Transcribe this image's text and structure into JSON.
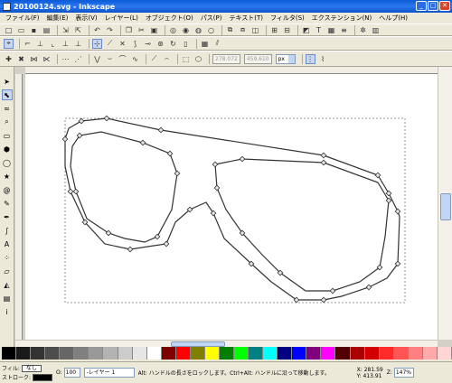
{
  "window": {
    "title": "20100124.svg - Inkscape"
  },
  "menu": [
    "ファイル(F)",
    "編集(E)",
    "表示(V)",
    "レイヤー(L)",
    "オブジェクト(O)",
    "パス(P)",
    "テキスト(T)",
    "フィルタ(S)",
    "エクステンション(N)",
    "ヘルプ(H)"
  ],
  "toolbar2": {
    "x_value": "278.072",
    "w_value": "459.610",
    "unit": "px"
  },
  "status": {
    "fill_label": "フィル:",
    "fill_value": "なし",
    "stroke_label": "ストローク:",
    "opacity_label": "O:",
    "opacity_value": "100",
    "layer": "-レイヤー 1",
    "message": "Alt: ハンドルの長さをロックします。Ctrl+Alt: ハンドルに沿って移動します。",
    "x_label": "X:",
    "x_value": "281.59",
    "y_label": "Y:",
    "y_value": "413.91",
    "zoom_label": "Z:",
    "zoom_value": "147%"
  },
  "colors": {
    "titlebar": "#0a5bd8",
    "path_stroke": "#333333",
    "node": "#e6e6e6"
  },
  "icons": {
    "tools": [
      "selector-icon",
      "node-icon",
      "tweak-icon",
      "zoom-icon",
      "rect-icon",
      "3dbox-icon",
      "ellipse-icon",
      "star-icon",
      "spiral-icon",
      "pencil-icon",
      "pen-icon",
      "calligraphy-icon",
      "text-icon",
      "spray-icon",
      "eraser-icon",
      "bucket-icon",
      "gradient-icon",
      "dropper-icon"
    ]
  }
}
